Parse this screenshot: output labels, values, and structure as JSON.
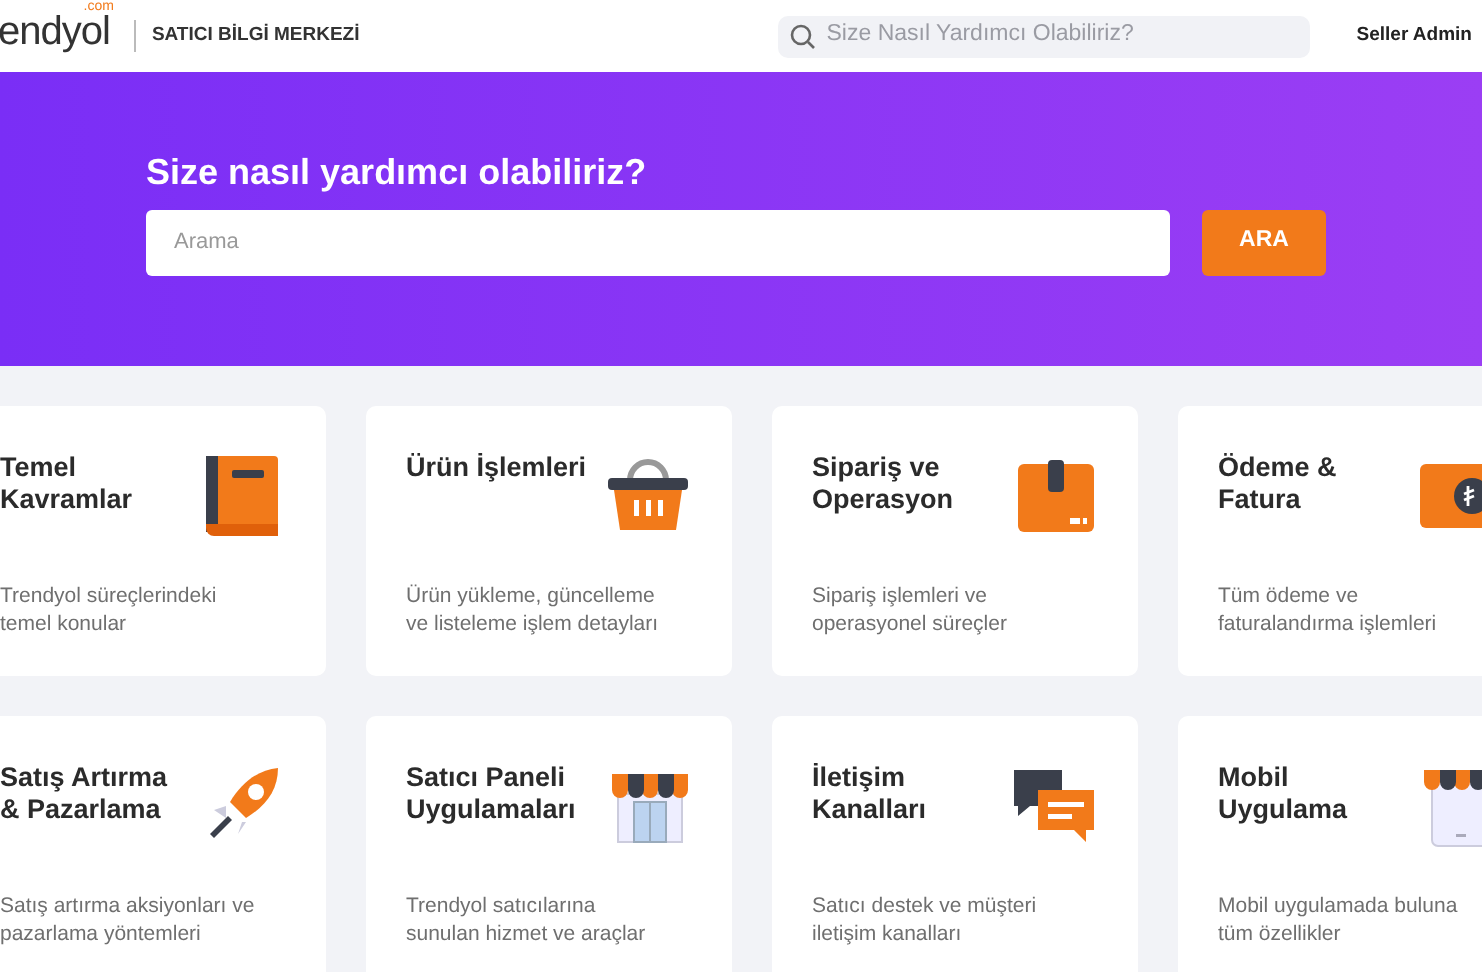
{
  "header": {
    "logo_text": "endyol",
    "logo_suffix": ".com",
    "section_title": "SATICI BİLGİ MERKEZİ",
    "search_placeholder": "Size Nasıl Yardımcı Olabiliriz?",
    "user_name": "Seller Admin"
  },
  "hero": {
    "title": "Size nasıl yardımcı olabiliriz?",
    "search_placeholder": "Arama",
    "button": "ARA"
  },
  "categories": [
    {
      "title_lines": [
        "Temel",
        "Kavramlar"
      ],
      "description_lines": [
        "Trendyol süreçlerindeki",
        "temel konular"
      ],
      "kind": "category"
    },
    {
      "title_lines": [
        "Ürün İşlemleri"
      ],
      "description_lines": [
        "Ürün yükleme, güncelleme",
        "ve listeleme işlem detayları"
      ],
      "kind": "category"
    },
    {
      "title_lines": [
        "Sipariş ve",
        "Operasyon"
      ],
      "description_lines": [
        "Sipariş işlemleri ve",
        "operasyonel süreçler"
      ],
      "kind": "category"
    },
    {
      "title_lines": [
        "Ödeme &",
        "Fatura"
      ],
      "description_lines": [
        "Tüm ödeme ve",
        "faturalandırma işlemleri"
      ],
      "kind": "category"
    },
    {
      "title_lines": [
        "Satış Artırma",
        "& Pazarlama"
      ],
      "description_lines": [
        "Satış artırma aksiyonları ve",
        "pazarlama yöntemleri"
      ],
      "kind": "category"
    },
    {
      "title_lines": [
        "Satıcı Paneli",
        "Uygulamaları"
      ],
      "description_lines": [
        "Trendyol satıcılarına",
        "sunulan hizmet ve araçlar"
      ],
      "kind": "category"
    },
    {
      "title_lines": [
        "İletişim",
        "Kanalları"
      ],
      "description_lines": [
        "Satıcı destek ve müşteri",
        "iletişim kanalları"
      ],
      "kind": "category"
    },
    {
      "title_lines": [
        "Mobil",
        "Uygulama"
      ],
      "description_lines": [
        "Mobil uygulamada buluna",
        "tüm özellikler"
      ],
      "kind": "category"
    }
  ]
}
